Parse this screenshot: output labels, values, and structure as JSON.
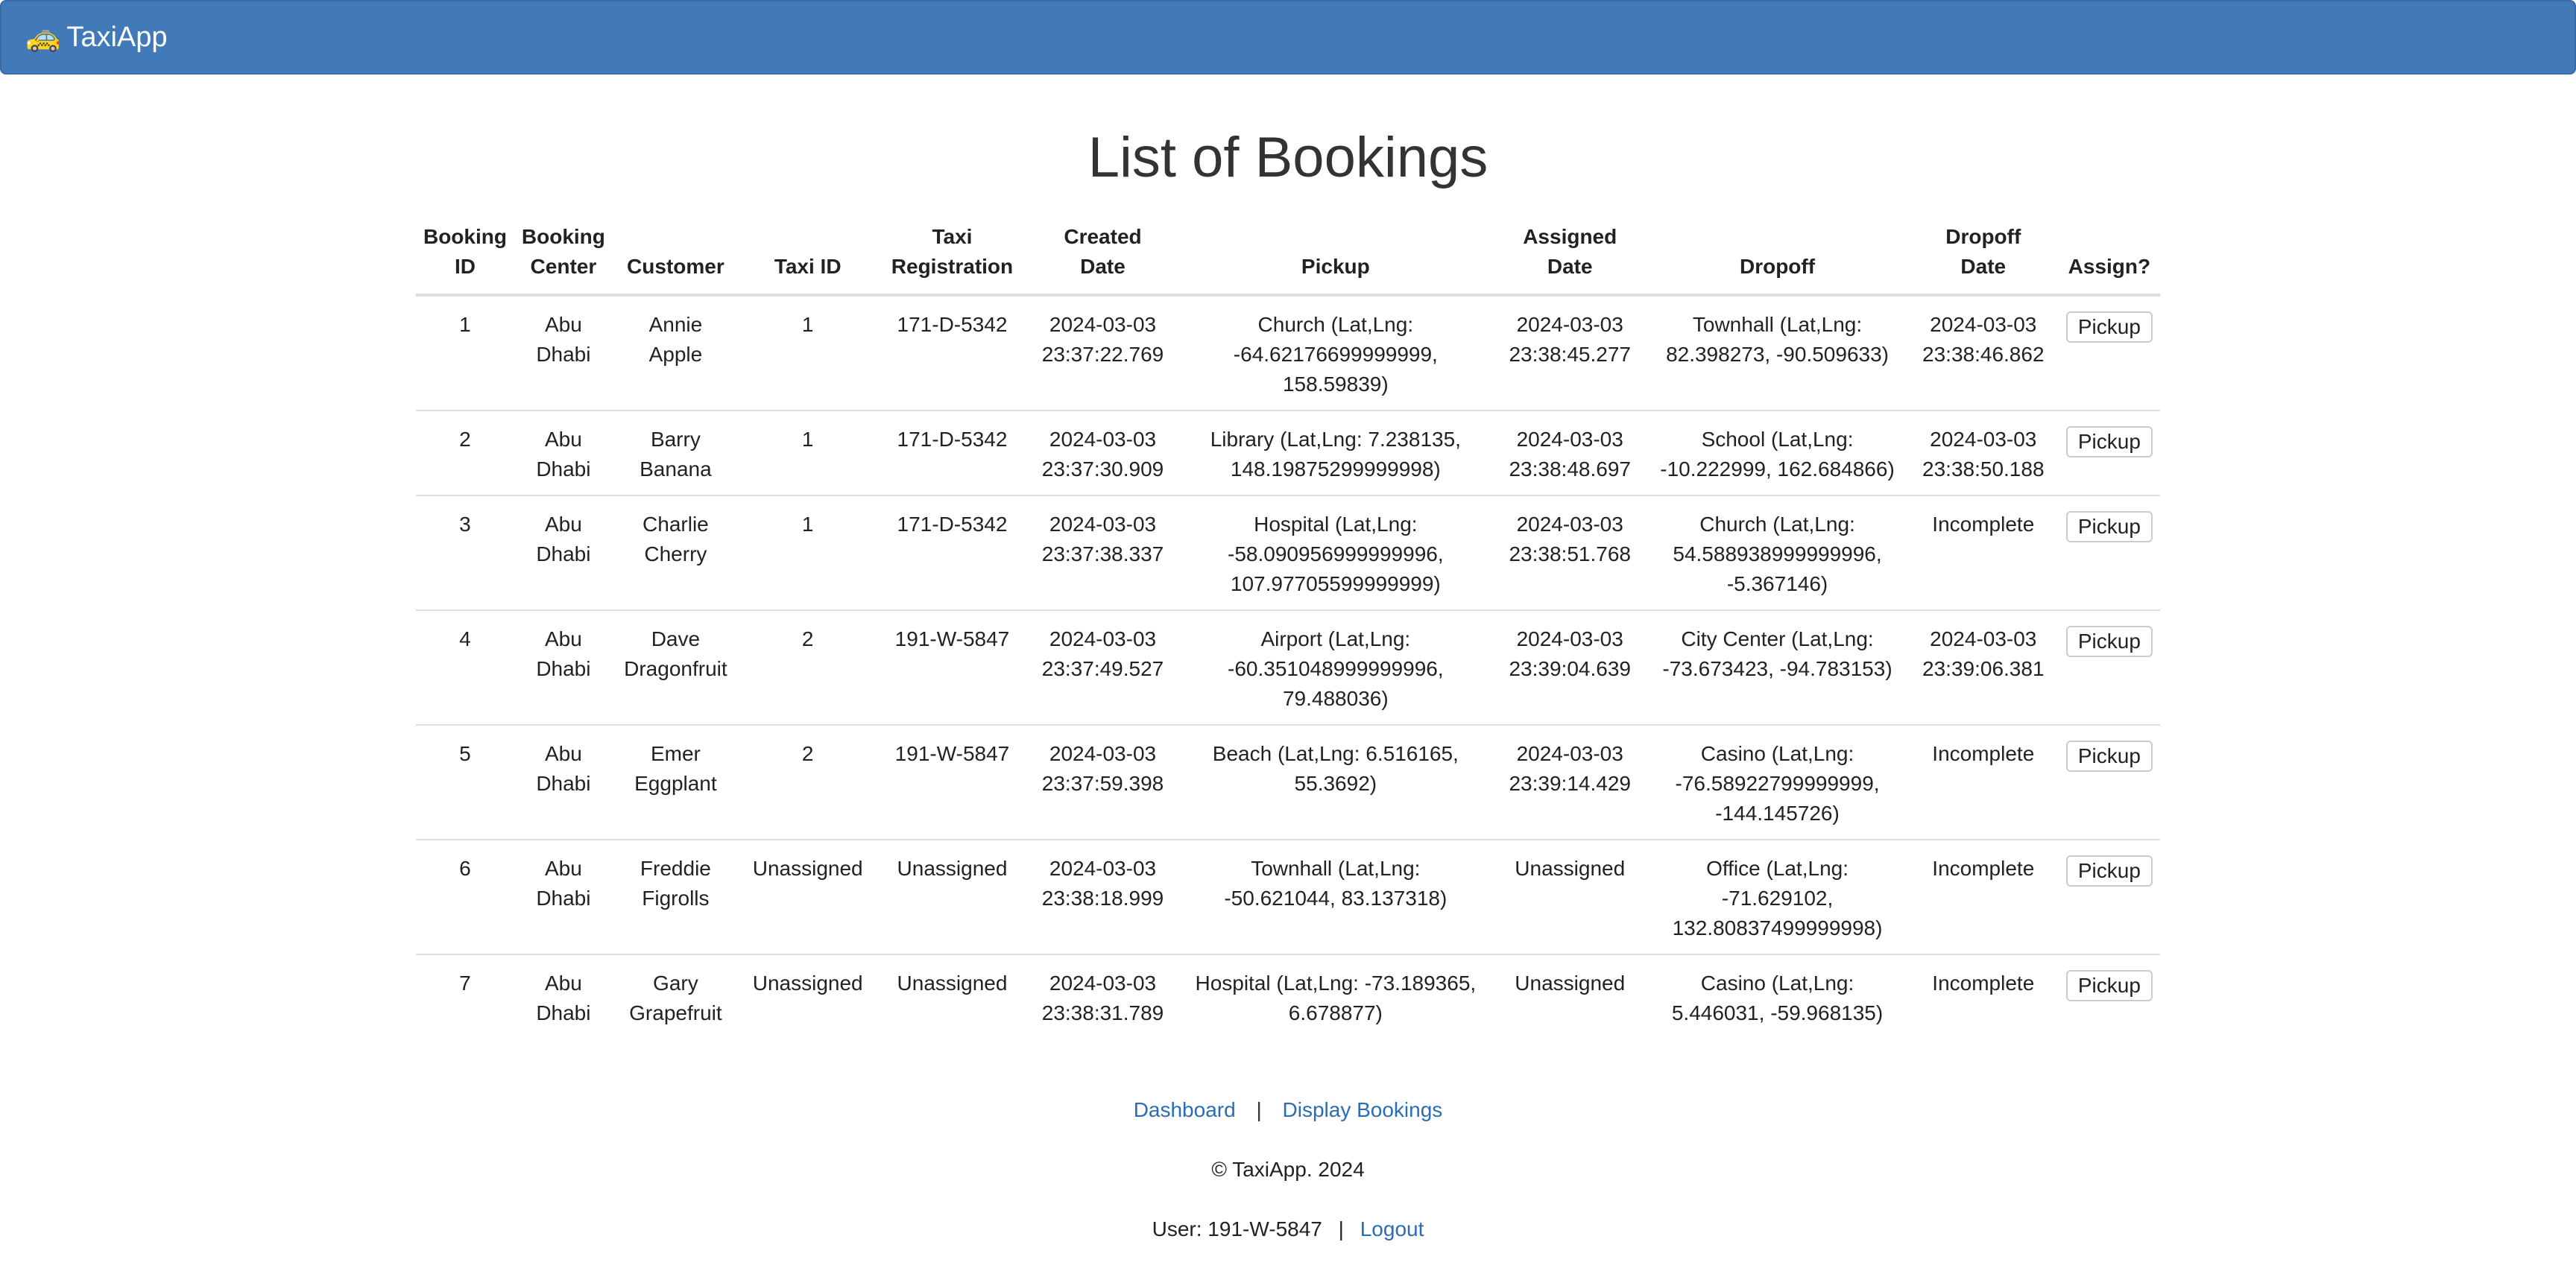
{
  "navbar": {
    "icon": "taxi-icon",
    "brand": "TaxiApp",
    "color": "#4279b8"
  },
  "page": {
    "title": "List of Bookings"
  },
  "table": {
    "headers": {
      "booking_id": [
        "Booking",
        "ID"
      ],
      "booking_center": [
        "Booking",
        "Center"
      ],
      "customer": "Customer",
      "taxi_id": "Taxi ID",
      "taxi_registration": [
        "Taxi",
        "Registration"
      ],
      "created_date": [
        "Created",
        "Date"
      ],
      "pickup": "Pickup",
      "assigned_date": [
        "Assigned",
        "Date"
      ],
      "dropoff": "Dropoff",
      "dropoff_date": [
        "Dropoff",
        "Date"
      ],
      "assign": "Assign?"
    },
    "rows": [
      {
        "id": "1",
        "center": [
          "Abu",
          "Dhabi"
        ],
        "customer": [
          "Annie",
          "Apple"
        ],
        "taxi_id": "1",
        "reg": "171-D-5342",
        "created": [
          "2024-03-03",
          "23:37:22.769"
        ],
        "pickup": [
          "Church (Lat,Lng:",
          "-64.62176699999999,",
          "158.59839)"
        ],
        "assigned": [
          "2024-03-03",
          "23:38:45.277"
        ],
        "dropoff": [
          "Townhall (Lat,Lng:",
          "82.398273, -90.509633)"
        ],
        "dropoff_date": [
          "2024-03-03",
          "23:38:46.862"
        ],
        "action": "Pickup"
      },
      {
        "id": "2",
        "center": [
          "Abu",
          "Dhabi"
        ],
        "customer": [
          "Barry",
          "Banana"
        ],
        "taxi_id": "1",
        "reg": "171-D-5342",
        "created": [
          "2024-03-03",
          "23:37:30.909"
        ],
        "pickup": [
          "Library (Lat,Lng: 7.238135,",
          "148.19875299999998)"
        ],
        "assigned": [
          "2024-03-03",
          "23:38:48.697"
        ],
        "dropoff": [
          "School (Lat,Lng:",
          "-10.222999, 162.684866)"
        ],
        "dropoff_date": [
          "2024-03-03",
          "23:38:50.188"
        ],
        "action": "Pickup"
      },
      {
        "id": "3",
        "center": [
          "Abu",
          "Dhabi"
        ],
        "customer": [
          "Charlie",
          "Cherry"
        ],
        "taxi_id": "1",
        "reg": "171-D-5342",
        "created": [
          "2024-03-03",
          "23:37:38.337"
        ],
        "pickup": [
          "Hospital (Lat,Lng:",
          "-58.090956999999996,",
          "107.97705599999999)"
        ],
        "assigned": [
          "2024-03-03",
          "23:38:51.768"
        ],
        "dropoff": [
          "Church (Lat,Lng:",
          "54.588938999999996,",
          "-5.367146)"
        ],
        "dropoff_date": [
          "Incomplete"
        ],
        "action": "Pickup"
      },
      {
        "id": "4",
        "center": [
          "Abu",
          "Dhabi"
        ],
        "customer": [
          "Dave",
          "Dragonfruit"
        ],
        "taxi_id": "2",
        "reg": "191-W-5847",
        "created": [
          "2024-03-03",
          "23:37:49.527"
        ],
        "pickup": [
          "Airport (Lat,Lng:",
          "-60.351048999999996,",
          "79.488036)"
        ],
        "assigned": [
          "2024-03-03",
          "23:39:04.639"
        ],
        "dropoff": [
          "City Center (Lat,Lng:",
          "-73.673423, -94.783153)"
        ],
        "dropoff_date": [
          "2024-03-03",
          "23:39:06.381"
        ],
        "action": "Pickup"
      },
      {
        "id": "5",
        "center": [
          "Abu",
          "Dhabi"
        ],
        "customer": [
          "Emer",
          "Eggplant"
        ],
        "taxi_id": "2",
        "reg": "191-W-5847",
        "created": [
          "2024-03-03",
          "23:37:59.398"
        ],
        "pickup": [
          "Beach (Lat,Lng: 6.516165,",
          "55.3692)"
        ],
        "assigned": [
          "2024-03-03",
          "23:39:14.429"
        ],
        "dropoff": [
          "Casino (Lat,Lng:",
          "-76.58922799999999,",
          "-144.145726)"
        ],
        "dropoff_date": [
          "Incomplete"
        ],
        "action": "Pickup"
      },
      {
        "id": "6",
        "center": [
          "Abu",
          "Dhabi"
        ],
        "customer": [
          "Freddie",
          "Figrolls"
        ],
        "taxi_id": "Unassigned",
        "reg": "Unassigned",
        "created": [
          "2024-03-03",
          "23:38:18.999"
        ],
        "pickup": [
          "Townhall (Lat,Lng:",
          "-50.621044, 83.137318)"
        ],
        "assigned": [
          "Unassigned"
        ],
        "dropoff": [
          "Office (Lat,Lng:",
          "-71.629102,",
          "132.80837499999998)"
        ],
        "dropoff_date": [
          "Incomplete"
        ],
        "action": "Pickup"
      },
      {
        "id": "7",
        "center": [
          "Abu",
          "Dhabi"
        ],
        "customer": [
          "Gary",
          "Grapefruit"
        ],
        "taxi_id": "Unassigned",
        "reg": "Unassigned",
        "created": [
          "2024-03-03",
          "23:38:31.789"
        ],
        "pickup": [
          "Hospital (Lat,Lng: -73.189365,",
          "6.678877)"
        ],
        "assigned": [
          "Unassigned"
        ],
        "dropoff": [
          "Casino (Lat,Lng:",
          "5.446031, -59.968135)"
        ],
        "dropoff_date": [
          "Incomplete"
        ],
        "action": "Pickup"
      }
    ]
  },
  "footer": {
    "links": {
      "dashboard": "Dashboard",
      "separator": "|",
      "display_bookings": "Display Bookings"
    },
    "copyright": "© TaxiApp. 2024",
    "user": {
      "label": "User: 191-W-5847",
      "separator": "|",
      "logout": "Logout"
    },
    "link_color": "#2a6db5"
  }
}
